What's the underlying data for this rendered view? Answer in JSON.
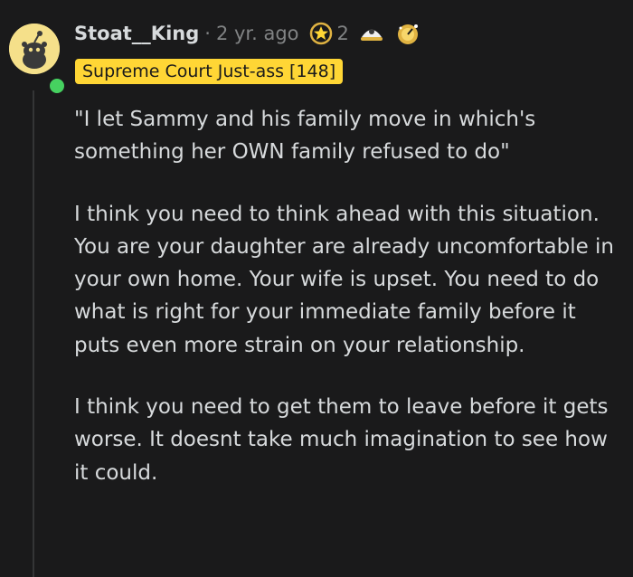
{
  "comment": {
    "username": "Stoat__King",
    "separator": "·",
    "age": "2 yr. ago",
    "award_count": "2",
    "awards": [
      {
        "icon": "star-wreath-award-icon"
      },
      {
        "icon": "helmet-award-icon"
      },
      {
        "icon": "gold-gauge-award-icon"
      }
    ],
    "flair": "Supreme Court Just-ass [148]",
    "paragraphs": [
      "\"I let Sammy and his family move in which's something her OWN family refused to do\"",
      "I think you need to think ahead with this situation. You are your daughter are already uncomfortable in your own home. Your wife is upset. You need to do what is right for your immediate family before it puts even more strain on your relationship.",
      "I think you need to get them to leave before it gets worse. It doesnt take much imagination to see how it could."
    ],
    "colors": {
      "background": "#1a1a1b",
      "text": "#d7dadc",
      "meta": "#818384",
      "flair_bg": "#ffd635",
      "online": "#46d160",
      "avatar_bg": "#f5e08a"
    }
  }
}
